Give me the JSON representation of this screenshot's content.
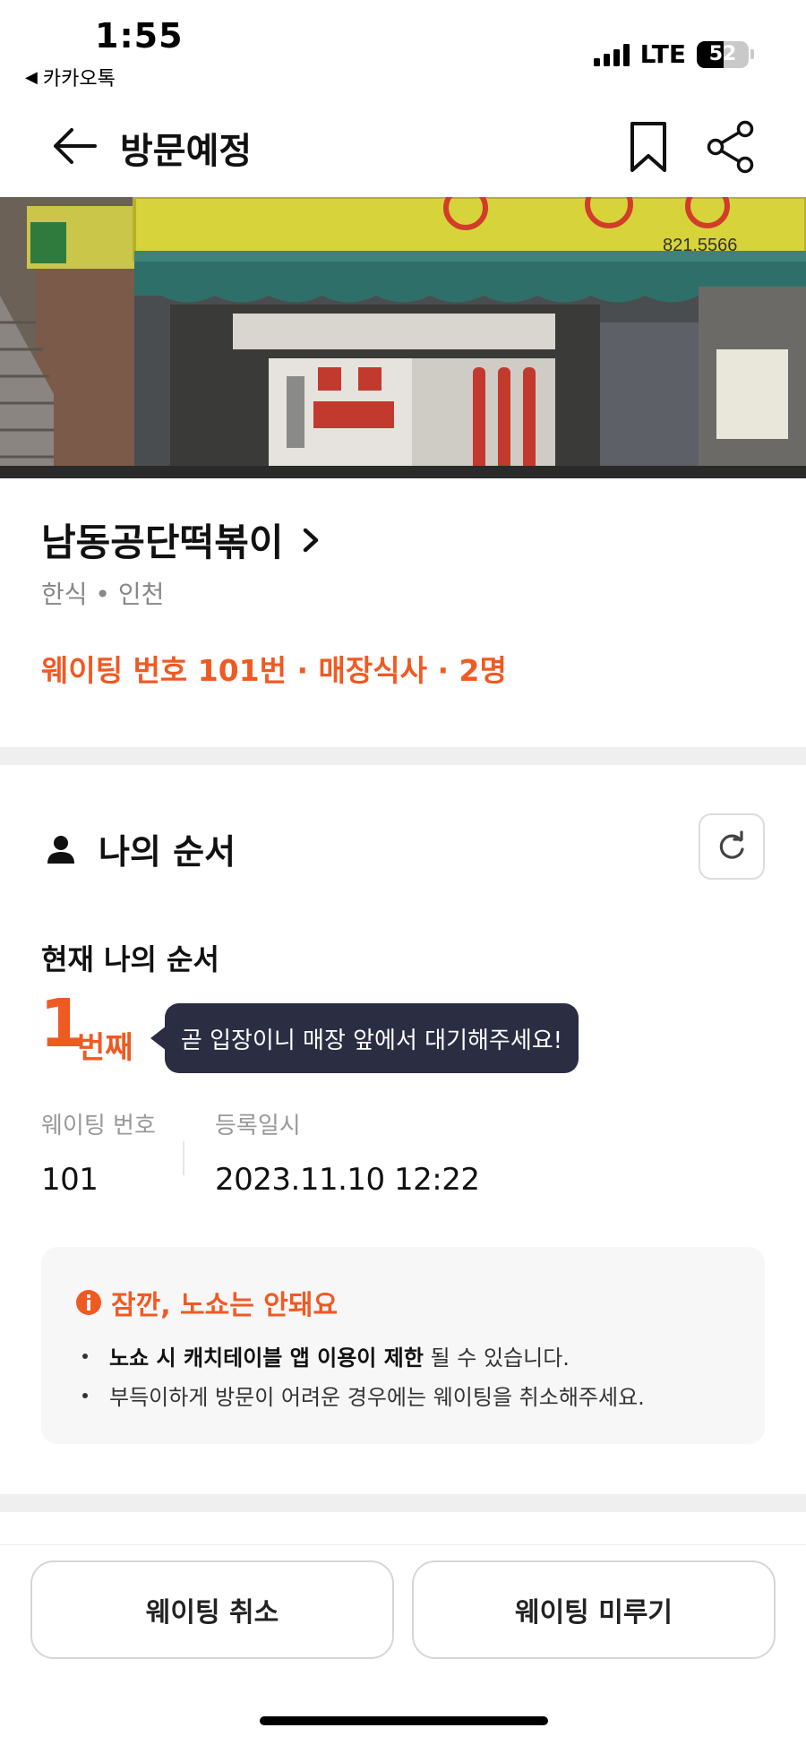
{
  "status_bar": {
    "time": "1:55",
    "back_app": "카카오톡",
    "network": "LTE",
    "battery": "52"
  },
  "header": {
    "title": "방문예정"
  },
  "store": {
    "name": "남동공단떡볶이",
    "category": "한식 • 인천",
    "waiting_summary": "웨이팅 번호 101번 · 매장식사 · 2명",
    "signboard_phone": "821.5566"
  },
  "my_turn": {
    "section_title": "나의 순서",
    "current_label": "현재 나의 순서",
    "position": "1",
    "position_suffix": "번째",
    "tooltip": "곧 입장이니 매장 앞에서 대기해주세요!",
    "waiting_number_label": "웨이팅 번호",
    "waiting_number": "101",
    "registered_label": "등록일시",
    "registered_at": "2023.11.10 12:22"
  },
  "notice": {
    "title": "잠깐, 노쇼는 안돼요",
    "item1_bold": "노쇼 시 캐치테이블 앱 이용이 제한",
    "item1_rest": " 될 수 있습니다.",
    "item2": "부득이하게 방문이 어려운 경우에는 웨이팅을 취소해주세요."
  },
  "actions": {
    "cancel_label": "웨이팅 취소",
    "postpone_label": "웨이팅 미루기"
  },
  "colors": {
    "accent": "#ef5a23",
    "tooltip_bg": "#2b2d42"
  }
}
